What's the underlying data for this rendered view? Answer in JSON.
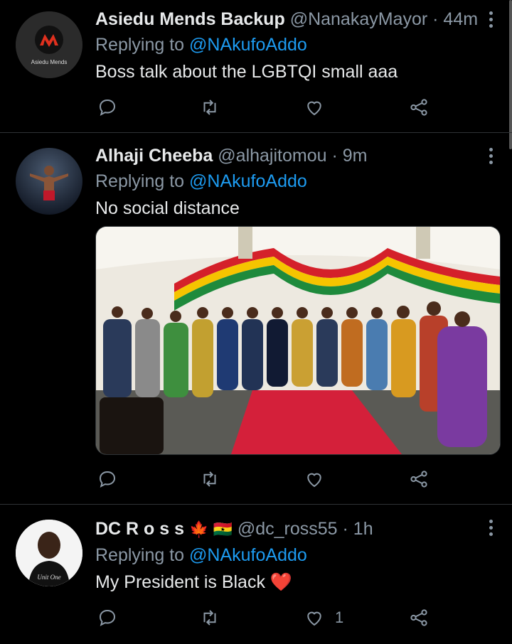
{
  "tweets": [
    {
      "name": "Asiedu Mends Backup",
      "handle": "@NanakayMayor",
      "time": "· 44m",
      "replying_prefix": "Replying to ",
      "replying_to": "@NAkufoAddo",
      "text": "Boss talk about the LGBTQI small aaa",
      "avatar_text": "Asiedu Mends",
      "like_count": ""
    },
    {
      "name": "Alhaji Cheeba",
      "handle": "@alhajitomou",
      "time": "· 9m",
      "replying_prefix": "Replying to ",
      "replying_to": "@NAkufoAddo",
      "text": "No social distance",
      "like_count": ""
    },
    {
      "name": "DC R o s s",
      "flags": "🍁 🇬🇭",
      "handle": "@dc_ross55",
      "time": "· 1h",
      "replying_prefix": "Replying to ",
      "replying_to": "@NAkufoAddo",
      "text": "My President is Black",
      "text_emoji": "❤️",
      "avatar_text": "Unit One",
      "like_count": "1"
    }
  ],
  "colors": {
    "background": "#000000",
    "text": "#e7e9ea",
    "secondary": "#8b98a5",
    "link": "#1d9bf0",
    "divider": "#2f3336"
  },
  "icons": [
    "reply-icon",
    "retweet-icon",
    "like-icon",
    "share-icon",
    "more-icon"
  ]
}
